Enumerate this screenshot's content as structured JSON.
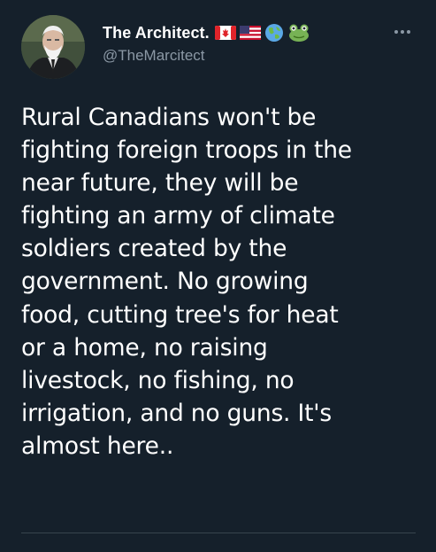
{
  "author": {
    "display_name": "The Architect.",
    "handle": "@TheMarcitect",
    "badges": [
      "canada-flag-icon",
      "usa-flag-icon",
      "globe-icon",
      "frog-icon"
    ]
  },
  "tweet": {
    "text_lines": [
      "Rural Canadians won't be",
      "fighting foreign troops in the",
      "near future, they will be",
      "fighting an army of climate",
      "soldiers created by the",
      "government. No growing",
      "food, cutting tree's for heat",
      "or a home, no raising",
      "livestock, no fishing, no",
      "irrigation, and no guns. It's",
      "almost here.."
    ]
  },
  "colors": {
    "background": "#15202b",
    "text": "#ffffff",
    "secondary_text": "#8b98a5",
    "divider": "#38444d"
  }
}
